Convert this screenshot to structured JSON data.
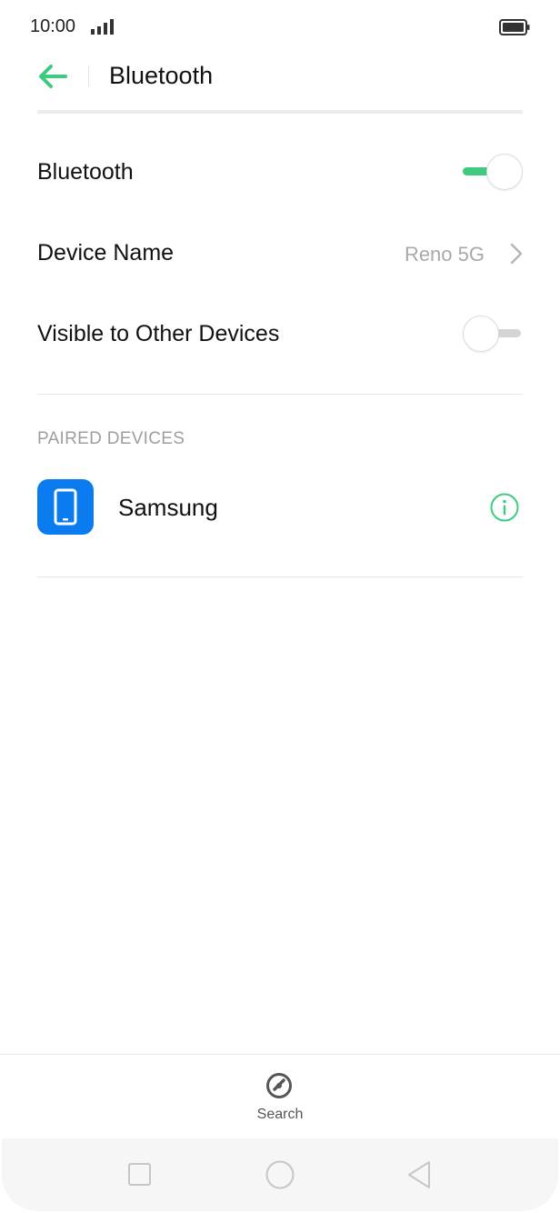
{
  "status_bar": {
    "time": "10:00",
    "signal_icon": "signal-icon",
    "battery_icon": "battery-icon"
  },
  "app_bar": {
    "title": "Bluetooth",
    "back_icon": "arrow-left-icon"
  },
  "settings": {
    "bluetooth": {
      "label": "Bluetooth",
      "enabled": true
    },
    "device_name": {
      "label": "Device Name",
      "value": "Reno 5G"
    },
    "visible": {
      "label": "Visible to Other Devices",
      "enabled": false
    }
  },
  "paired": {
    "header": "PAIRED DEVICES",
    "devices": [
      {
        "name": "Samsung",
        "icon": "smartphone-icon"
      }
    ]
  },
  "bottom_action": {
    "label": "Search",
    "icon": "search-icon"
  },
  "nav": {
    "recents_icon": "square-icon",
    "home_icon": "circle-icon",
    "back_icon": "triangle-back-icon"
  },
  "colors": {
    "accent": "#3ecb80",
    "device_icon_bg": "#0b7bf0",
    "secondary_text": "#a9a9a9"
  }
}
